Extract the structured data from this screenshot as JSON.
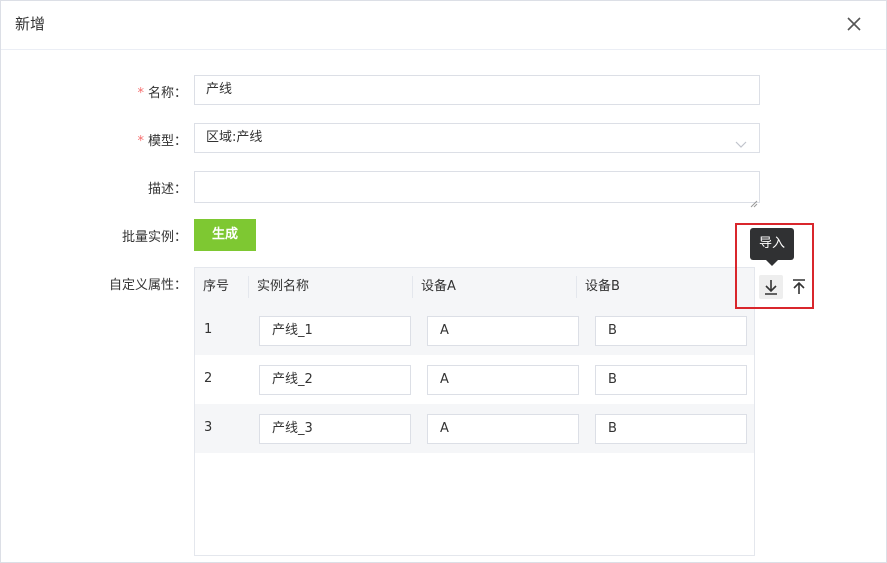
{
  "dialog": {
    "title": "新增"
  },
  "form": {
    "name": {
      "label": "名称：",
      "required_mark": "*",
      "value": "产线"
    },
    "model": {
      "label": "模型：",
      "required_mark": "*",
      "value": "区域:产线"
    },
    "desc": {
      "label": "描述：",
      "value": ""
    },
    "batch": {
      "label": "批量实例：",
      "button": "生成"
    },
    "custom": {
      "label": "自定义属性："
    }
  },
  "table": {
    "headers": [
      "序号",
      "实例名称",
      "设备A",
      "设备B"
    ],
    "rows": [
      {
        "idx": "1",
        "name": "产线_1",
        "a": "A",
        "b": "B"
      },
      {
        "idx": "2",
        "name": "产线_2",
        "a": "A",
        "b": "B"
      },
      {
        "idx": "3",
        "name": "产线_3",
        "a": "A",
        "b": "B"
      }
    ]
  },
  "actions": {
    "tooltip": "导入",
    "import_icon": "download-icon",
    "export_icon": "upload-icon"
  },
  "colors": {
    "accent_green": "#7ec832",
    "required_red": "#f56c6c",
    "highlight_red": "#d9262c"
  }
}
